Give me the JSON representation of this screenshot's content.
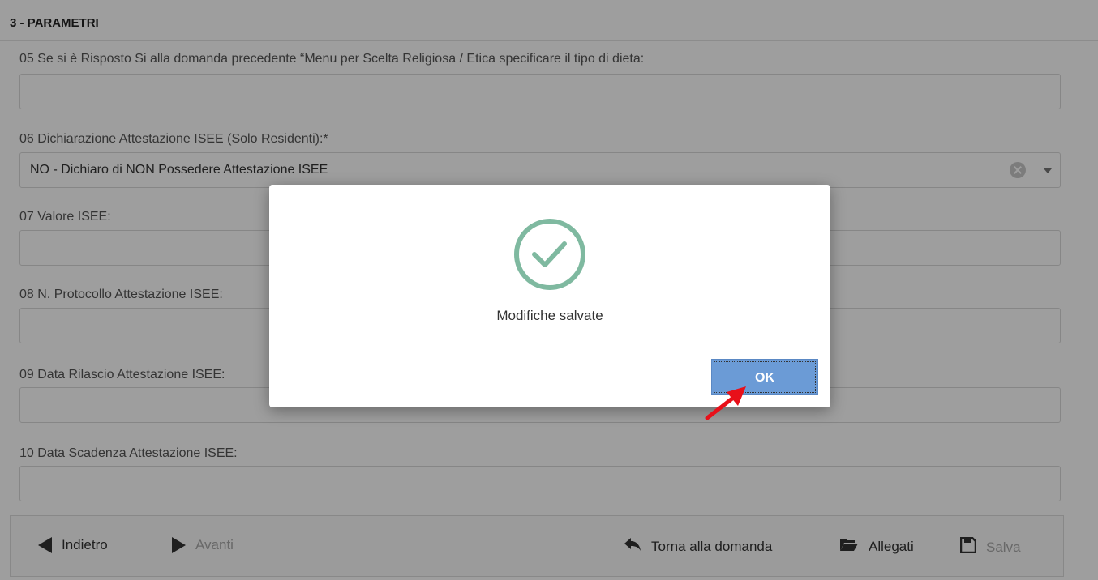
{
  "section": {
    "title": "3 - PARAMETRI"
  },
  "fields": [
    {
      "label": "05 Se si è Risposto Si alla domanda precedente “Menu per Scelta Religiosa / Etica specificare il tipo di dieta:",
      "value": ""
    },
    {
      "label": "06 Dichiarazione Attestazione ISEE (Solo Residenti):*",
      "value": "NO - Dichiaro di NON Possedere Attestazione ISEE"
    },
    {
      "label": "07 Valore ISEE:",
      "value": ""
    },
    {
      "label": "08 N. Protocollo Attestazione ISEE:",
      "value": ""
    },
    {
      "label": "09 Data Rilascio Attestazione ISEE:",
      "value": ""
    },
    {
      "label": "10 Data Scadenza Attestazione ISEE:",
      "value": ""
    }
  ],
  "footer": {
    "back_label": "Indietro",
    "next_label": "Avanti",
    "return_label": "Torna alla domanda",
    "attachments_label": "Allegati",
    "save_label": "Salva"
  },
  "modal": {
    "message": "Modifiche salvate",
    "ok_label": "OK",
    "icon": "check-circle-icon",
    "icon_color": "#7fb9a0",
    "button_color": "#6b9bd6"
  },
  "annotation": {
    "arrow_color": "#e8101a"
  }
}
